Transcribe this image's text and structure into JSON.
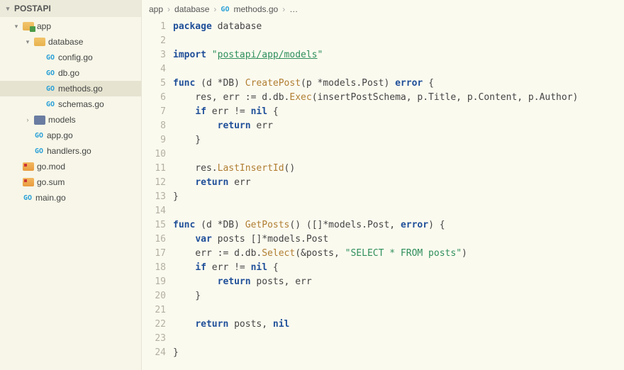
{
  "sidebar": {
    "root_label": "POSTAPI",
    "items": [
      {
        "label": "app",
        "depth": 1,
        "kind": "folder-root",
        "arrow": "down"
      },
      {
        "label": "database",
        "depth": 2,
        "kind": "folder",
        "arrow": "down"
      },
      {
        "label": "config.go",
        "depth": 3,
        "kind": "go"
      },
      {
        "label": "db.go",
        "depth": 3,
        "kind": "go"
      },
      {
        "label": "methods.go",
        "depth": 3,
        "kind": "go",
        "selected": true
      },
      {
        "label": "schemas.go",
        "depth": 3,
        "kind": "go"
      },
      {
        "label": "models",
        "depth": 2,
        "kind": "models",
        "arrow": "right"
      },
      {
        "label": "app.go",
        "depth": 2,
        "kind": "go"
      },
      {
        "label": "handlers.go",
        "depth": 2,
        "kind": "go"
      },
      {
        "label": "go.mod",
        "depth": 1,
        "kind": "mod"
      },
      {
        "label": "go.sum",
        "depth": 1,
        "kind": "mod"
      },
      {
        "label": "main.go",
        "depth": 1,
        "kind": "go"
      }
    ]
  },
  "breadcrumbs": {
    "seg0": "app",
    "seg1": "database",
    "seg2": "methods.go",
    "tail": "…"
  },
  "code": {
    "lines": [
      [
        {
          "t": "package ",
          "c": "kw"
        },
        {
          "t": "database"
        }
      ],
      [],
      [
        {
          "t": "import ",
          "c": "kw"
        },
        {
          "t": "\"",
          "c": "str"
        },
        {
          "t": "postapi/app/models",
          "c": "str und"
        },
        {
          "t": "\"",
          "c": "str"
        }
      ],
      [],
      [
        {
          "t": "func ",
          "c": "kw"
        },
        {
          "t": "(d *DB) "
        },
        {
          "t": "CreatePost",
          "c": "fn"
        },
        {
          "t": "(p *models.Post) "
        },
        {
          "t": "error",
          "c": "kw"
        },
        {
          "t": " {"
        }
      ],
      [
        {
          "t": "    res, err := d.db."
        },
        {
          "t": "Exec",
          "c": "fn"
        },
        {
          "t": "(insertPostSchema, p.Title, p.Content, p.Author)"
        }
      ],
      [
        {
          "t": "    "
        },
        {
          "t": "if ",
          "c": "kw"
        },
        {
          "t": "err != "
        },
        {
          "t": "nil",
          "c": "kw"
        },
        {
          "t": " {"
        }
      ],
      [
        {
          "t": "      ",
          "c": "cgap"
        },
        {
          "t": "  "
        },
        {
          "t": "return ",
          "c": "kw"
        },
        {
          "t": "err"
        }
      ],
      [
        {
          "t": "    }"
        }
      ],
      [],
      [
        {
          "t": "    res."
        },
        {
          "t": "LastInsertId",
          "c": "fn"
        },
        {
          "t": "()"
        }
      ],
      [
        {
          "t": "    "
        },
        {
          "t": "return ",
          "c": "kw"
        },
        {
          "t": "err"
        }
      ],
      [
        {
          "t": "}"
        }
      ],
      [],
      [
        {
          "t": "func ",
          "c": "kw"
        },
        {
          "t": "(d *DB) "
        },
        {
          "t": "GetPosts",
          "c": "fn"
        },
        {
          "t": "() ([]*models.Post, "
        },
        {
          "t": "error",
          "c": "kw"
        },
        {
          "t": ") {"
        }
      ],
      [
        {
          "t": "    "
        },
        {
          "t": "var ",
          "c": "kw"
        },
        {
          "t": "posts []*models.Post"
        }
      ],
      [
        {
          "t": "    err := d.db."
        },
        {
          "t": "Select",
          "c": "fn"
        },
        {
          "t": "(&posts, "
        },
        {
          "t": "\"SELECT * FROM posts\"",
          "c": "str"
        },
        {
          "t": ")"
        }
      ],
      [
        {
          "t": "    "
        },
        {
          "t": "if ",
          "c": "kw"
        },
        {
          "t": "err != "
        },
        {
          "t": "nil",
          "c": "kw"
        },
        {
          "t": " {"
        }
      ],
      [
        {
          "t": "      ",
          "c": "cgap"
        },
        {
          "t": "  "
        },
        {
          "t": "return ",
          "c": "kw"
        },
        {
          "t": "posts, err"
        }
      ],
      [
        {
          "t": "    }"
        }
      ],
      [],
      [
        {
          "t": "    "
        },
        {
          "t": "return ",
          "c": "kw"
        },
        {
          "t": "posts, "
        },
        {
          "t": "nil",
          "c": "kw"
        }
      ],
      [],
      [
        {
          "t": "}"
        }
      ]
    ]
  }
}
